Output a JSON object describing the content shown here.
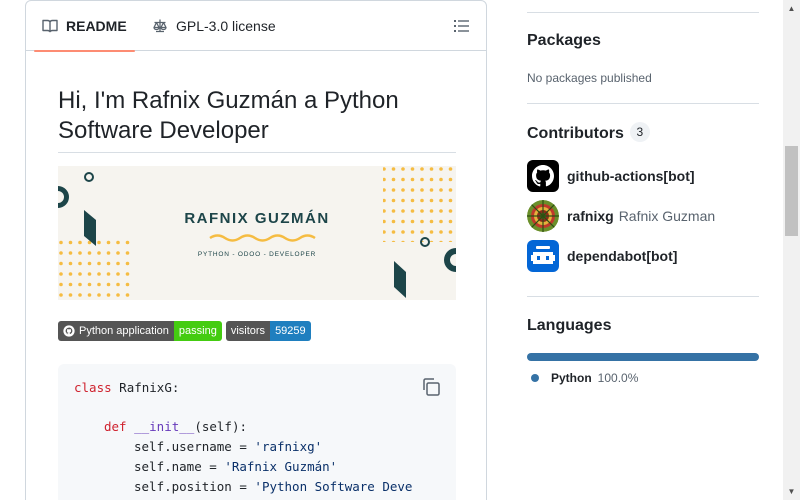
{
  "readme": {
    "tabs": [
      {
        "label": "README",
        "icon": "book-icon"
      },
      {
        "label": "GPL-3.0 license",
        "icon": "law-icon"
      }
    ],
    "title": "Hi, I'm Rafnix Guzmán a Python Software Developer",
    "banner": {
      "name": "RAFNIX GUZMÁN",
      "subtitle": "PYTHON - ODOO - DEVELOPER",
      "colors": {
        "bg": "#f6f4ef",
        "teal": "#1d4549",
        "yellow": "#f5bc42"
      }
    },
    "badges": [
      {
        "label": "Python application",
        "value": "passing",
        "color": "#44cc11"
      },
      {
        "label": "visitors",
        "value": "59259",
        "color": "#1f7fbf"
      }
    ],
    "code": {
      "line1_kw": "class",
      "line1_rest": " RafnixG:",
      "line2_kw": "def",
      "line2_fn": "__init__",
      "line2_rest": "(self):",
      "line3_pre": "self.username = ",
      "line3_str": "'rafnixg'",
      "line4_pre": "self.name = ",
      "line4_str": "'Rafnix Guzmán'",
      "line5_pre": "self.position = ",
      "line5_str": "'Python Software Deve"
    }
  },
  "sidebar": {
    "packages": {
      "heading": "Packages",
      "empty": "No packages published"
    },
    "contributors": {
      "heading": "Contributors",
      "count": "3",
      "items": [
        {
          "login": "github-actions[bot]",
          "full_name": ""
        },
        {
          "login": "rafnixg",
          "full_name": "Rafnix Guzman"
        },
        {
          "login": "dependabot[bot]",
          "full_name": ""
        }
      ]
    },
    "languages": {
      "heading": "Languages",
      "items": [
        {
          "name": "Python",
          "percent": "100.0%",
          "color": "#3572a5"
        }
      ]
    }
  },
  "theme": {
    "accent_underline": "#fd8c73",
    "border": "#d0d7de"
  }
}
